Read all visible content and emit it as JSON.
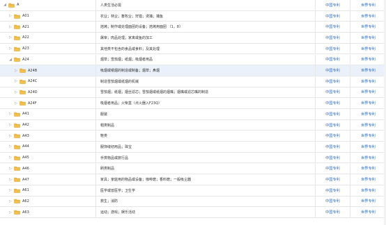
{
  "table": {
    "link_labels": {
      "china": "中国专利",
      "world": "世界专利"
    },
    "rows": [
      {
        "code": "A",
        "desc": "人类生活必需",
        "level": 0,
        "expanded": true,
        "selected": false
      },
      {
        "code": "A01",
        "desc": "农业；林业；畜牧业；狩猎；诱捕；捕鱼",
        "level": 1,
        "expanded": false,
        "selected": false
      },
      {
        "code": "A21",
        "desc": "焙烤；制作或处理面团的设备；焙烤用面团 〔1，8〕",
        "level": 1,
        "expanded": false,
        "selected": false
      },
      {
        "code": "A22",
        "desc": "屠宰；肉品处理；家禽或鱼的加工",
        "level": 1,
        "expanded": false,
        "selected": false
      },
      {
        "code": "A23",
        "desc": "其他类不包含的食品或食料；及其处理",
        "level": 1,
        "expanded": false,
        "selected": false
      },
      {
        "code": "A24",
        "desc": "烟草；雪茄烟；纸烟；吸烟者用品",
        "level": 1,
        "expanded": true,
        "selected": false
      },
      {
        "code": "A24B",
        "desc": "吸烟或嚼烟的制造或制备；烟草；鼻烟",
        "level": 2,
        "expanded": false,
        "selected": true
      },
      {
        "code": "A24C",
        "desc": "制造雪茄烟或纸烟的机械",
        "level": 2,
        "expanded": false,
        "selected": false
      },
      {
        "code": "A24D",
        "desc": "雪茄烟；纸烟；烟丝滤芯；雪茄烟或纸烟的烟嘴；烟嘴或滤芯嘴的制造",
        "level": 2,
        "expanded": false,
        "selected": false
      },
      {
        "code": "A24F",
        "desc": "吸烟者用品；火柴盒（点火器入F23Q）",
        "level": 2,
        "expanded": false,
        "selected": false
      },
      {
        "code": "A41",
        "desc": "服装",
        "level": 1,
        "expanded": false,
        "selected": false
      },
      {
        "code": "A42",
        "desc": "帽类制品",
        "level": 1,
        "expanded": false,
        "selected": false
      },
      {
        "code": "A43",
        "desc": "鞋类",
        "level": 1,
        "expanded": false,
        "selected": false
      },
      {
        "code": "A44",
        "desc": "服饰缝纫用品；珠宝",
        "level": 1,
        "expanded": false,
        "selected": false
      },
      {
        "code": "A45",
        "desc": "手携物品或旅行品",
        "level": 1,
        "expanded": false,
        "selected": false
      },
      {
        "code": "A46",
        "desc": "刷类制品",
        "level": 1,
        "expanded": false,
        "selected": false
      },
      {
        "code": "A47",
        "desc": "家具；家庭用的物品或设备；咖啡磨；香料磨；一般吸尘器",
        "level": 1,
        "expanded": false,
        "selected": false
      },
      {
        "code": "A61",
        "desc": "医学或兽医学；卫生学",
        "level": 1,
        "expanded": false,
        "selected": false
      },
      {
        "code": "A62",
        "desc": "救生；消防",
        "level": 1,
        "expanded": false,
        "selected": false
      },
      {
        "code": "A63",
        "desc": "运动；游戏；娱乐活动",
        "level": 1,
        "expanded": false,
        "selected": false
      }
    ]
  }
}
